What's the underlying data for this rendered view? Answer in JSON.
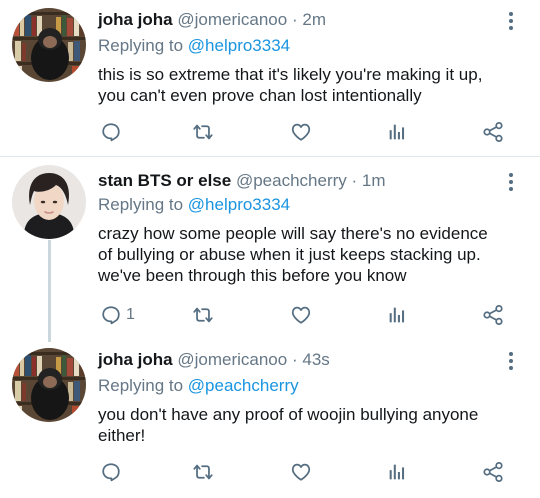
{
  "tweets": [
    {
      "name": "joha joha",
      "handle": "@jomericanoo",
      "time": "2m",
      "reply_prefix": "Replying to",
      "reply_to": "@helpro3334",
      "text_lines": [
        "this is so extreme that it's likely you're making it up,",
        "you can't even prove chan lost intentionally"
      ],
      "reply_count": ""
    },
    {
      "name": "stan BTS or else",
      "handle": "@peachcherry",
      "time": "1m",
      "reply_prefix": "Replying to",
      "reply_to": "@helpro3334",
      "text_lines": [
        "crazy how some people will say there's no evidence",
        "of bullying or abuse when it just keeps stacking up.",
        "we've been through this before you know"
      ],
      "reply_count": "1"
    },
    {
      "name": "joha joha",
      "handle": "@jomericanoo",
      "time": "43s",
      "reply_prefix": "Replying to",
      "reply_to": "@peachcherry",
      "text_lines": [
        "you don't have any proof of woojin bullying anyone",
        "either!"
      ],
      "reply_count": ""
    }
  ],
  "separator": "·",
  "icons": [
    "reply-icon",
    "retweet-icon",
    "like-icon",
    "stats-icon",
    "share-icon",
    "more-icon"
  ],
  "colors": {
    "accent": "#1b95e0",
    "icon": "#546d80",
    "muted": "#657786",
    "thread_line": "#ccd6dd"
  }
}
